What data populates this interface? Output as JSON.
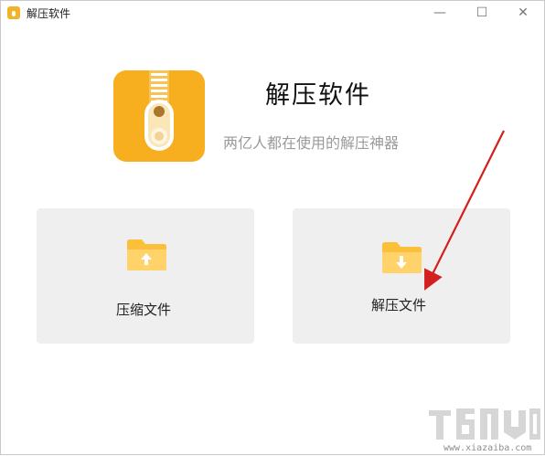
{
  "window": {
    "title": "解压软件",
    "controls": {
      "minimize": "—",
      "maximize": "☐",
      "close": "✕"
    }
  },
  "header": {
    "title": "解压软件",
    "subtitle": "两亿人都在使用的解压神器",
    "logo_icon": "zipper-icon"
  },
  "actions": [
    {
      "label": "压缩文件",
      "icon": "folder-upload-icon"
    },
    {
      "label": "解压文件",
      "icon": "folder-download-icon"
    }
  ],
  "watermark": {
    "text": "www.xiazaiba.com"
  },
  "colors": {
    "brand": "#f7ae1f",
    "card_bg": "#efefef",
    "subtitle": "#9a9a9a",
    "arrow": "#d21f1f"
  }
}
